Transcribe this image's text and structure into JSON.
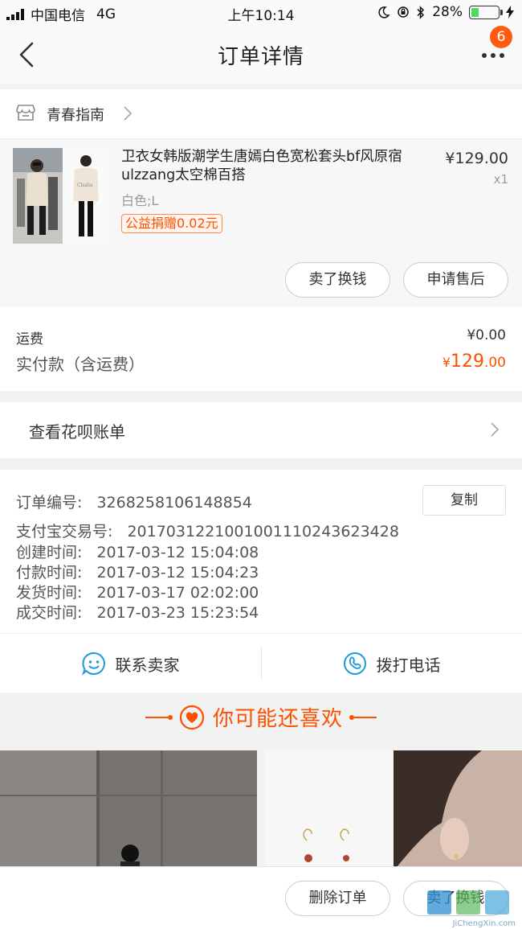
{
  "status_bar": {
    "carrier": "中国电信",
    "network": "4G",
    "time": "上午10:14",
    "battery": "28%",
    "battery_level": 0.28
  },
  "nav": {
    "title": "订单详情",
    "badge": "6"
  },
  "shop": {
    "name": "青春指南"
  },
  "item": {
    "title": "卫衣女韩版潮学生唐嫣白色宽松套头bf风原宿ulzzang太空棉百搭",
    "price": "¥129.00",
    "qty": "x1",
    "sku": "白色;L",
    "tag": "公益捐赠0.02元",
    "buttons": [
      "卖了换钱",
      "申请售后"
    ]
  },
  "fee": {
    "shipping_label": "运费",
    "shipping_value": "¥0.00",
    "paid_label": "实付款（含运费）",
    "paid_currency": "¥",
    "paid_int": "129",
    "paid_dec": ".00"
  },
  "huabei": {
    "label": "查看花呗账单"
  },
  "order_info": {
    "copy_label": "复制",
    "rows": [
      {
        "k": "订单编号:",
        "v": "3268258106148854"
      },
      {
        "k": "支付宝交易号:",
        "v": "2017031221001001110243623428"
      },
      {
        "k": "创建时间:",
        "v": "2017-03-12 15:04:08"
      },
      {
        "k": "付款时间:",
        "v": "2017-03-12 15:04:23"
      },
      {
        "k": "发货时间:",
        "v": "2017-03-17 02:02:00"
      },
      {
        "k": "成交时间:",
        "v": "2017-03-23 15:23:54"
      }
    ]
  },
  "contact": {
    "seller": "联系卖家",
    "phone": "拨打电话"
  },
  "recommend": {
    "title": "你可能还喜欢"
  },
  "bottom": {
    "delete": "删除订单",
    "sell": "卖了换钱"
  },
  "watermark": {
    "text": "JiChengXin.com"
  },
  "colors": {
    "accent": "#ff5000",
    "badge": "#ff5b0f",
    "contact_icon": "#1a9bd7"
  },
  "icons": [
    "back-arrow-icon",
    "more-dots-icon",
    "shop-icon",
    "chevron-right-icon",
    "smile-chat-icon",
    "phone-icon",
    "heart-icon"
  ]
}
